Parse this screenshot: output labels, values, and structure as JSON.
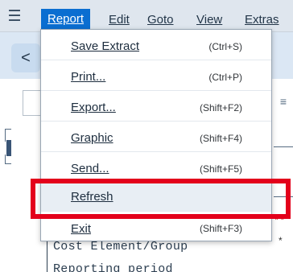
{
  "menubar": {
    "hamburger_icon": "hamburger-menu-icon",
    "items": [
      "Report",
      "Edit",
      "Goto",
      "View",
      "Extras"
    ]
  },
  "header": {
    "back_icon": "chevron-left-icon",
    "back_glyph": "<"
  },
  "background": {
    "line1": "Cost Element/Group",
    "line2": "Reporting period",
    "right_mark": "**",
    "star": "*"
  },
  "dropdown": {
    "items": [
      {
        "label": "Save Extract",
        "shortcut": "(Ctrl+S)"
      },
      {
        "label": "Print...",
        "shortcut": "(Ctrl+P)"
      },
      {
        "label": "Export...",
        "shortcut": "(Shift+F2)"
      },
      {
        "label": "Graphic",
        "shortcut": "(Shift+F4)"
      },
      {
        "label": "Send...",
        "shortcut": "(Shift+F5)"
      },
      {
        "label": "Refresh",
        "shortcut": ""
      },
      {
        "label": "Exit",
        "shortcut": "(Shift+F3)"
      }
    ],
    "highlighted_item": "Refresh"
  },
  "colors": {
    "menubar_bg": "#dfe6ee",
    "active_tab_bg": "#0a6ed1",
    "highlight_border": "#e3001b"
  }
}
